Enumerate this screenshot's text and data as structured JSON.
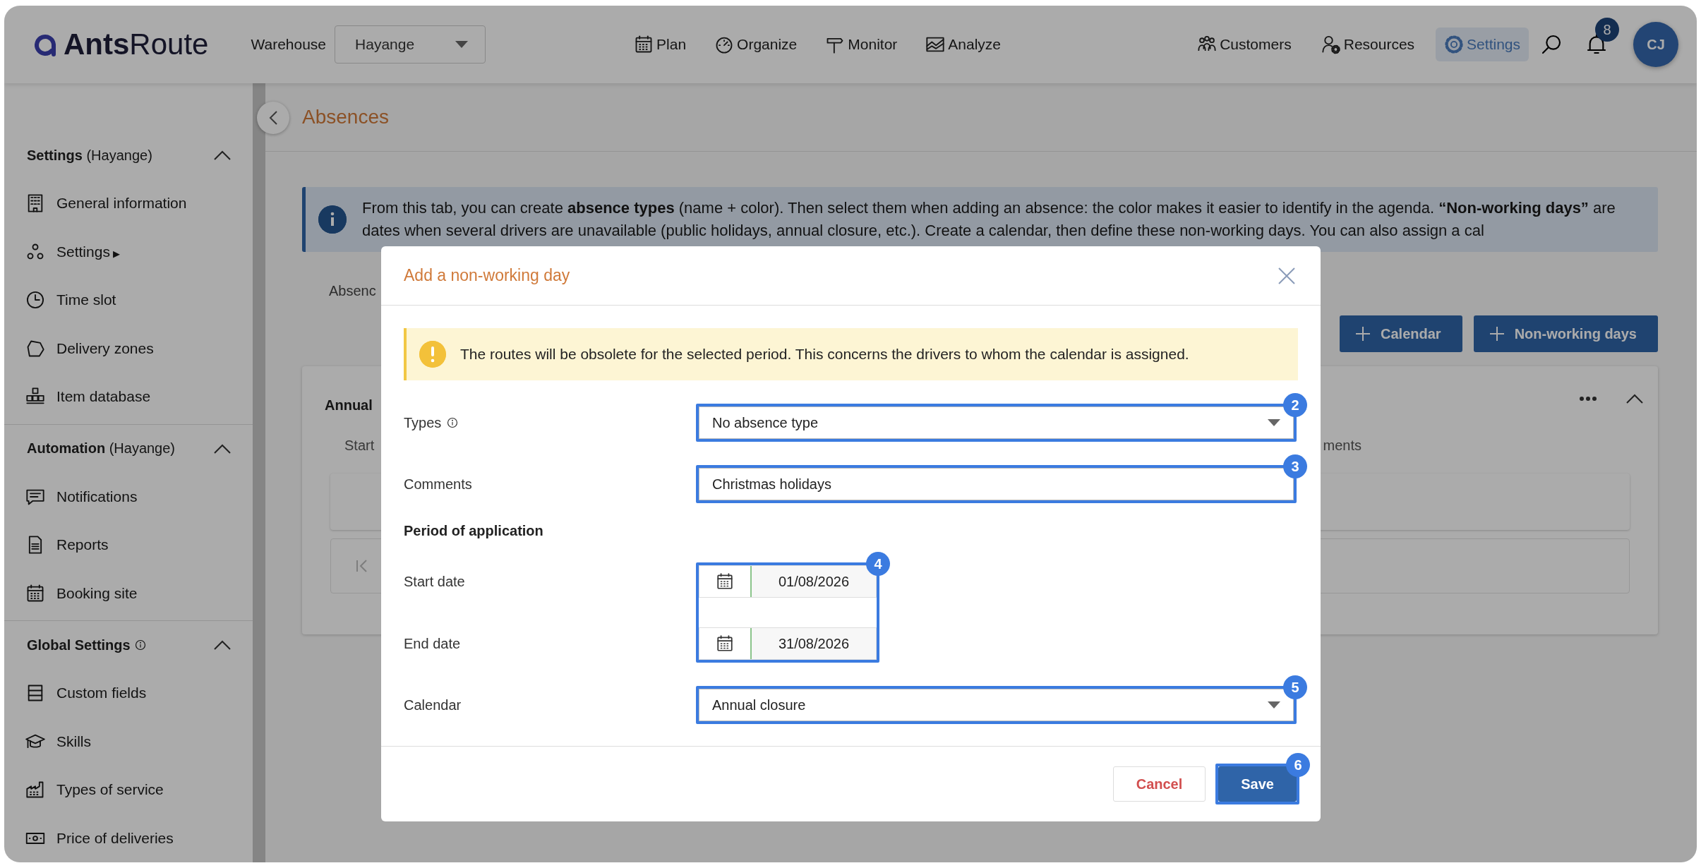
{
  "topbar": {
    "logo": {
      "bold": "Ants",
      "light": "Route"
    },
    "warehouse_label": "Warehouse",
    "warehouse": "Hayange",
    "nav": [
      {
        "label": "Plan"
      },
      {
        "label": "Organize"
      },
      {
        "label": "Monitor"
      },
      {
        "label": "Analyze"
      }
    ],
    "tools": [
      {
        "label": "Customers",
        "selected": false
      },
      {
        "label": "Resources",
        "selected": false
      },
      {
        "label": "Settings",
        "selected": true
      }
    ],
    "notifications": "8",
    "avatar": "CJ"
  },
  "sidebar": {
    "sections": [
      {
        "title": "Settings",
        "scope": "(Hayange)",
        "info": false,
        "expanded": true,
        "items": [
          {
            "label": "General information"
          },
          {
            "label": "Settings",
            "arrow": "▶"
          },
          {
            "label": "Time slot"
          },
          {
            "label": "Delivery zones"
          },
          {
            "label": "Item database"
          }
        ]
      },
      {
        "title": "Automation",
        "scope": "(Hayange)",
        "info": false,
        "expanded": true,
        "items": [
          {
            "label": "Notifications"
          },
          {
            "label": "Reports"
          },
          {
            "label": "Booking site"
          }
        ]
      },
      {
        "title": "Global Settings",
        "info": true,
        "expanded": true,
        "items": [
          {
            "label": "Custom fields"
          },
          {
            "label": "Skills"
          },
          {
            "label": "Types of service"
          },
          {
            "label": "Price of deliveries"
          }
        ]
      }
    ]
  },
  "page": {
    "title": "Absences",
    "banner": "From this tab, you can create **absence types** (name + color). Then select them when adding an absence: the color makes it easier to identify in the agenda. **“Non-working days”** are dates when several drivers are unavailable (public holidays, annual closure, etc.). Create a calendar, then define these non-working days. You can also assign a cal",
    "tab": "Absenc",
    "buttons": [
      "Calendar",
      "Non-working days"
    ],
    "card": {
      "title": "Annual",
      "columns": [
        "Start",
        "ments"
      ]
    }
  },
  "modal": {
    "title": "Add a non-working day",
    "warning": "The routes will be obsolete for the selected period. This concerns the drivers to whom the calendar is assigned.",
    "rows": [
      {
        "kind": "select",
        "label": "Types",
        "info": true,
        "value": "No absence type",
        "callout": "2"
      },
      {
        "kind": "text",
        "label": "Comments",
        "value": "Christmas holidays",
        "callout": "3"
      },
      {
        "kind": "heading",
        "label": "Period of application"
      },
      {
        "kind": "dates",
        "callout": "4",
        "items": [
          {
            "label": "Start date",
            "value": "01/08/2026"
          },
          {
            "label": "End date",
            "value": "31/08/2026"
          }
        ]
      },
      {
        "kind": "select",
        "label": "Calendar",
        "info": false,
        "value": "Annual closure",
        "callout": "5"
      }
    ],
    "buttons": [
      {
        "kind": "secondary",
        "label": "Cancel"
      },
      {
        "kind": "primary",
        "label": "Save",
        "callout": "6"
      }
    ]
  }
}
